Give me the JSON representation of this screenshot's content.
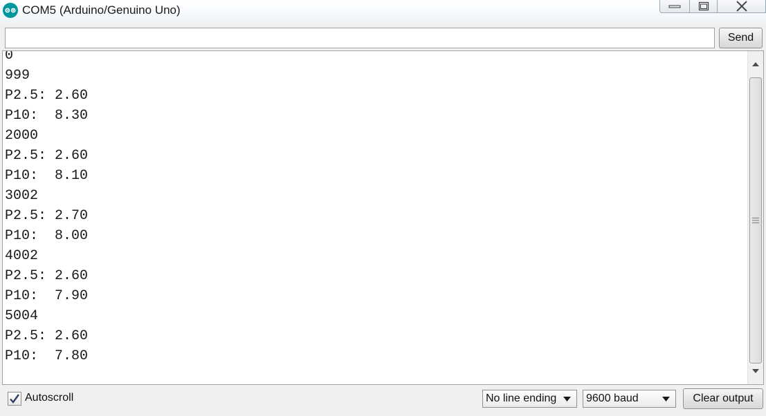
{
  "window": {
    "title": "COM5 (Arduino/Genuino Uno)",
    "icon": "arduino-logo-icon",
    "accent_color": "#00979d"
  },
  "send_bar": {
    "input_value": "",
    "send_label": "Send"
  },
  "output": {
    "lines": [
      "0",
      "999",
      "P2.5: 2.60",
      "P10:  8.30",
      "2000",
      "P2.5: 2.60",
      "P10:  8.10",
      "3002",
      "P2.5: 2.70",
      "P10:  8.00",
      "4002",
      "P2.5: 2.60",
      "P10:  7.90",
      "5004",
      "P2.5: 2.60",
      "P10:  7.80"
    ]
  },
  "footer": {
    "autoscroll_label": "Autoscroll",
    "autoscroll_checked": true,
    "line_ending_value": "No line ending",
    "baud_value": "9600 baud",
    "clear_label": "Clear output"
  }
}
